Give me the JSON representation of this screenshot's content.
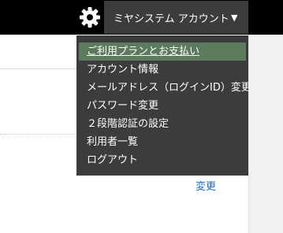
{
  "header": {
    "settings_icon": "gear-icon",
    "account_label": "ミヤシステム アカウント",
    "caret_glyph": "▼"
  },
  "menu": {
    "items": [
      {
        "label": "ご利用プランとお支払い",
        "active": true
      },
      {
        "label": "アカウント情報"
      },
      {
        "label": "メールアドレス（ログインID）変更"
      },
      {
        "label": "パスワード変更"
      },
      {
        "label": "２段階認証の設定"
      },
      {
        "label": "利用者一覧"
      },
      {
        "label": "ログアウト"
      }
    ]
  },
  "content": {
    "change_link": "変更"
  },
  "colors": {
    "topbar": "#000000",
    "menu_bg": "#3c3c3c",
    "menu_active": "#5c7a5c",
    "link": "#1a6bc4"
  }
}
